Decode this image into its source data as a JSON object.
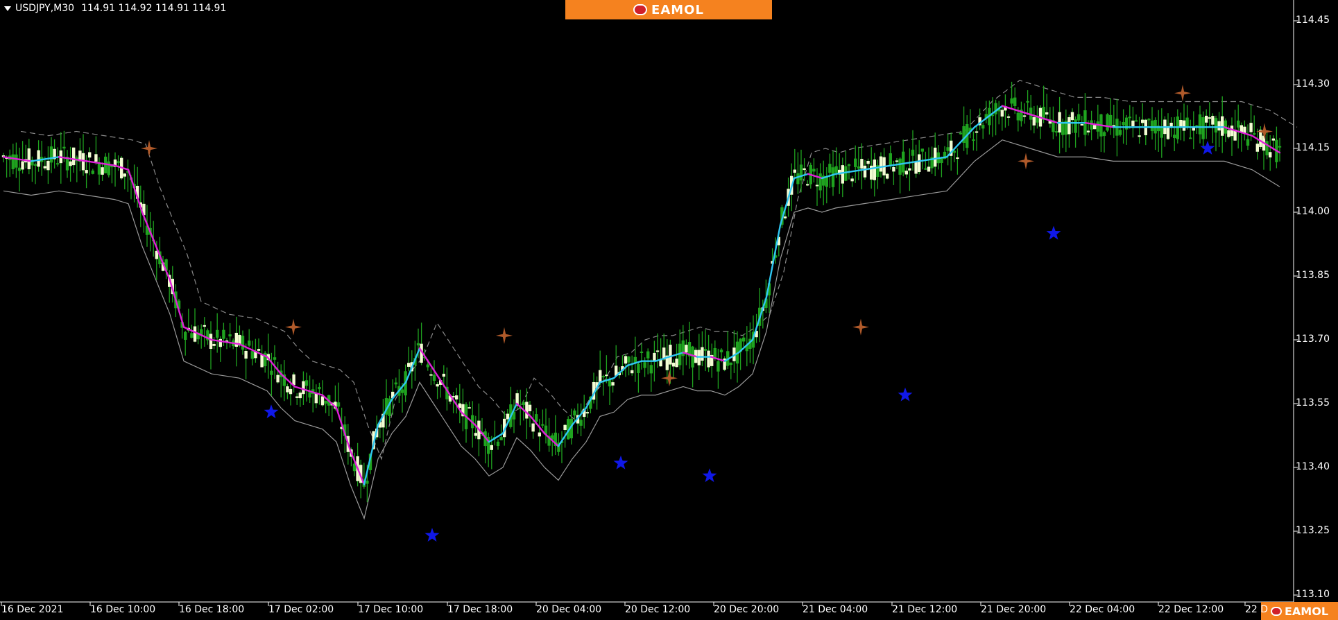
{
  "header": {
    "symbol": "USDJPY,M30",
    "quote": "114.91 114.92 114.91 114.91"
  },
  "brand": {
    "name": "EAMOL"
  },
  "colors": {
    "background": "#000000",
    "bull_candle": "#f2fcd2",
    "wick": "#1fa31f",
    "ma_up": "#2ec7f2",
    "ma_down": "#e020d8",
    "band_outer": "#9a9a9a",
    "band_dashed": "#8a8a8a",
    "sell_marker": "#b05a2a",
    "buy_marker": "#1018e8"
  },
  "chart_data": {
    "type": "line",
    "symbol": "USDJPY",
    "timeframe": "M30",
    "y_ticks": [
      "114.45",
      "114.30",
      "114.15",
      "114.00",
      "113.85",
      "113.70",
      "113.55",
      "113.40",
      "113.25",
      "113.10"
    ],
    "ylim": [
      113.05,
      114.47
    ],
    "x_ticks": [
      "16 Dec 2021",
      "16 Dec 10:00",
      "16 Dec 18:00",
      "17 Dec 02:00",
      "17 Dec 10:00",
      "17 Dec 18:00",
      "20 Dec 04:00",
      "20 Dec 12:00",
      "20 Dec 20:00",
      "21 Dec 04:00",
      "21 Dec 12:00",
      "21 Dec 20:00",
      "22 Dec 04:00",
      "22 Dec 12:00",
      "22 D"
    ],
    "series": [
      {
        "x": [
          0,
          40,
          80,
          120,
          160,
          180,
          200,
          240,
          260,
          300,
          340,
          380,
          400,
          420,
          440,
          460,
          480,
          500,
          520,
          540,
          560,
          580,
          600,
          620,
          640,
          660,
          680,
          700,
          720,
          740,
          760,
          780,
          800,
          820,
          840,
          860,
          880,
          900,
          920,
          940,
          960,
          980,
          1000,
          1020,
          1040,
          1060,
          1080,
          1100,
          1120,
          1140,
          1160,
          1180,
          1200,
          1240,
          1280,
          1320,
          1360,
          1400,
          1440,
          1480,
          1520,
          1560,
          1600,
          1640,
          1680,
          1720,
          1760,
          1800,
          1840
        ],
        "values": [
          114.13,
          114.12,
          114.13,
          114.12,
          114.11,
          114.1,
          114.0,
          113.84,
          113.73,
          113.7,
          113.69,
          113.66,
          113.62,
          113.59,
          113.58,
          113.57,
          113.54,
          113.44,
          113.36,
          113.5,
          113.56,
          113.6,
          113.68,
          113.63,
          113.58,
          113.53,
          113.5,
          113.46,
          113.48,
          113.55,
          113.52,
          113.48,
          113.45,
          113.5,
          113.54,
          113.6,
          113.61,
          113.64,
          113.65,
          113.65,
          113.66,
          113.67,
          113.66,
          113.66,
          113.65,
          113.67,
          113.7,
          113.8,
          113.97,
          114.08,
          114.09,
          114.08,
          114.09,
          114.1,
          114.11,
          114.12,
          114.13,
          114.2,
          114.25,
          114.23,
          114.21,
          114.21,
          114.2,
          114.2,
          114.2,
          114.2,
          114.2,
          114.18,
          114.14
        ]
      }
    ],
    "sell_signals": [
      {
        "x": 210,
        "y": 114.15
      },
      {
        "x": 418,
        "y": 113.73
      },
      {
        "x": 722,
        "y": 113.71
      },
      {
        "x": 960,
        "y": 113.61
      },
      {
        "x": 1236,
        "y": 113.73
      },
      {
        "x": 1474,
        "y": 114.12
      },
      {
        "x": 1700,
        "y": 114.28
      },
      {
        "x": 1818,
        "y": 114.19
      }
    ],
    "buy_signals": [
      {
        "x": 386,
        "y": 113.53
      },
      {
        "x": 618,
        "y": 113.24
      },
      {
        "x": 890,
        "y": 113.41
      },
      {
        "x": 1018,
        "y": 113.38
      },
      {
        "x": 1300,
        "y": 113.57
      },
      {
        "x": 1514,
        "y": 113.95
      },
      {
        "x": 1736,
        "y": 114.15
      }
    ],
    "grid": false,
    "legend": "none"
  }
}
